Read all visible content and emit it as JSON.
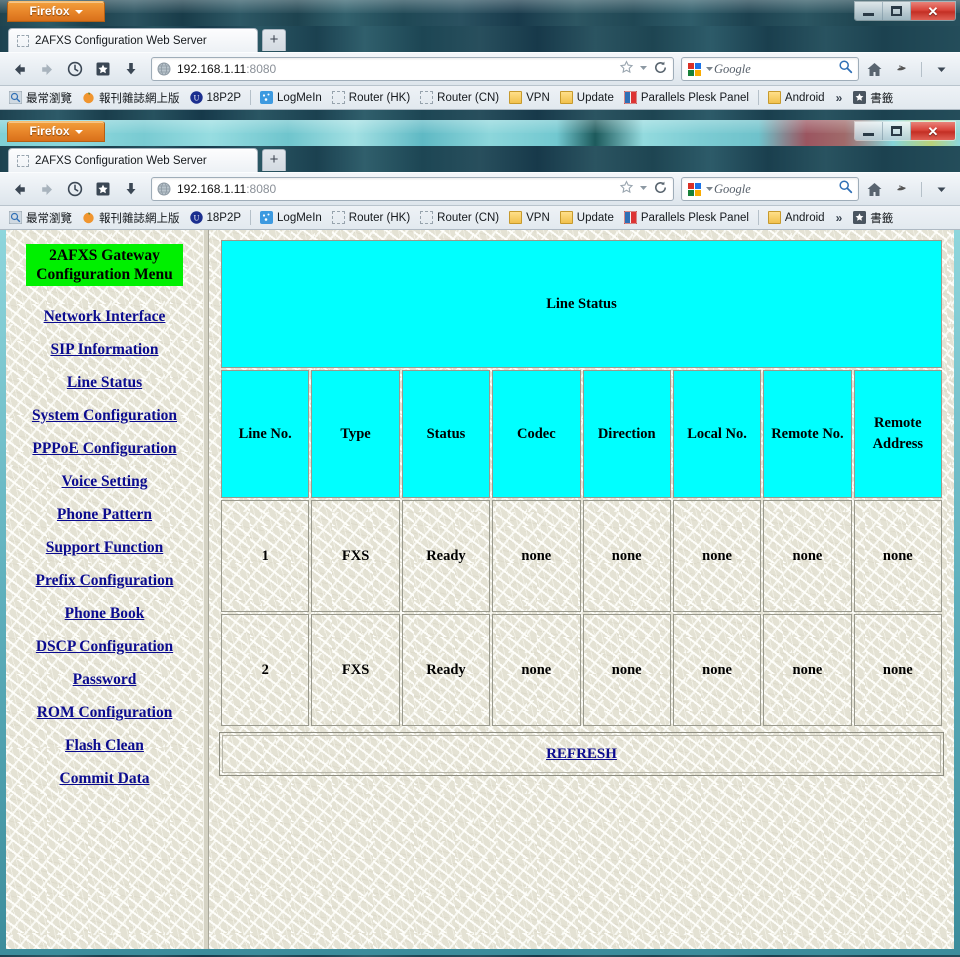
{
  "desktop": {
    "wallpaper_visible": true
  },
  "windows": [
    {
      "id": "window-back",
      "app_button_label": "Firefox",
      "tab": {
        "title": "2AFXS Configuration Web Server",
        "favicon": "blank-page-icon"
      },
      "newtab_label": "+",
      "url": {
        "host": "192.168.1.11",
        "port": ":8080"
      },
      "search": {
        "engine": "google-icon",
        "placeholder": "Google"
      },
      "controls": {
        "minimize": "minimize-icon",
        "restore": "restore-icon",
        "close": "close-icon"
      }
    },
    {
      "id": "window-front",
      "app_button_label": "Firefox",
      "tab": {
        "title": "2AFXS Configuration Web Server",
        "favicon": "blank-page-icon"
      },
      "newtab_label": "+",
      "url": {
        "host": "192.168.1.11",
        "port": ":8080"
      },
      "search": {
        "engine": "google-icon",
        "placeholder": "Google"
      },
      "controls": {
        "minimize": "minimize-icon",
        "restore": "restore-icon",
        "close": "close-icon"
      }
    }
  ],
  "bookmarks": {
    "items": [
      {
        "label": "最常瀏覽",
        "icon": "most-visited-icon"
      },
      {
        "label": "報刊雜誌網上版",
        "icon": "orange-circle-icon"
      },
      {
        "label": "18P2P",
        "icon": "18p2p-icon"
      },
      {
        "label": "LogMeIn",
        "icon": "logmein-icon"
      },
      {
        "label": "Router (HK)",
        "icon": "blank-page-icon"
      },
      {
        "label": "Router (CN)",
        "icon": "blank-page-icon"
      },
      {
        "label": "VPN",
        "icon": "folder-icon"
      },
      {
        "label": "Update",
        "icon": "folder-icon"
      },
      {
        "label": "Parallels Plesk Panel",
        "icon": "plesk-icon"
      },
      {
        "label": "Android",
        "icon": "folder-icon"
      }
    ],
    "overflow_label": "»",
    "bookmarks_label": "書籤",
    "bookmarks_icon": "star-icon"
  },
  "sidebar": {
    "title": "2AFXS Gateway\nConfiguration Menu",
    "title_bg": "#00f000",
    "items": [
      {
        "label": "Network Interface"
      },
      {
        "label": "SIP Information"
      },
      {
        "label": "Line Status"
      },
      {
        "label": "System\nConfiguration"
      },
      {
        "label": "PPPoE\nConfiguration"
      },
      {
        "label": "Voice Setting"
      },
      {
        "label": "Phone Pattern"
      },
      {
        "label": "Support Function"
      },
      {
        "label": "Prefix Configuration"
      },
      {
        "label": "Phone Book"
      },
      {
        "label": "DSCP Configuration"
      },
      {
        "label": "Password"
      },
      {
        "label": "ROM Configuration"
      },
      {
        "label": "Flash Clean"
      },
      {
        "label": "Commit Data"
      }
    ]
  },
  "main": {
    "banner": {
      "text": "Line Status",
      "bg": "#1400e4",
      "fg": "#ffe24a"
    },
    "table": {
      "header_bg": "#00ffff",
      "columns": [
        "Line\nNo.",
        "Type",
        "Status",
        "Codec",
        "Direction",
        "Local\nNo.",
        "Remote\nNo.",
        "Remote\nAddress"
      ],
      "rows": [
        [
          "1",
          "FXS",
          "Ready",
          "none",
          "none",
          "none",
          "none",
          "none"
        ],
        [
          "2",
          "FXS",
          "Ready",
          "none",
          "none",
          "none",
          "none",
          "none"
        ]
      ]
    },
    "refresh_label": "REFRESH"
  }
}
